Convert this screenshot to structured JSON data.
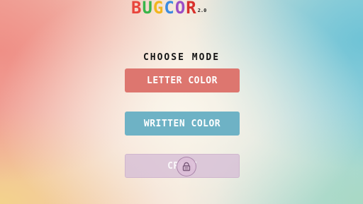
{
  "logo": {
    "letters": [
      {
        "char": "B",
        "color": "#e8453c"
      },
      {
        "char": "U",
        "color": "#3bb54a"
      },
      {
        "char": "G",
        "color": "#f2b51f"
      },
      {
        "char": "C",
        "color": "#3c8be0"
      },
      {
        "char": "O",
        "color": "#9b4fc6"
      },
      {
        "char": "R",
        "color": "#d8312c"
      }
    ],
    "version": "2.0"
  },
  "heading": "CHOOSE MODE",
  "modes": {
    "letter_color": {
      "label": "LETTER COLOR",
      "color": "#dd766f"
    },
    "written_color": {
      "label": "WRITTEN COLOR",
      "color": "#6eb2c5"
    },
    "crazy": {
      "label": "CRAZY",
      "locked": true,
      "icon": "lock-icon"
    }
  }
}
